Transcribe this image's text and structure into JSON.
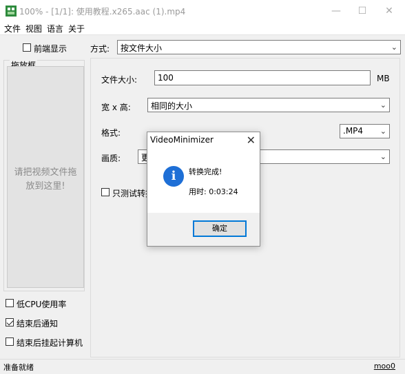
{
  "window": {
    "title": "100% - [1/1]: 使用教程.x265.aac (1).mp4",
    "minimize_glyph": "—",
    "maximize_glyph": "☐",
    "close_glyph": "✕"
  },
  "menu": [
    "文件",
    "视图",
    "语言",
    "关于"
  ],
  "left": {
    "topmost_label": "前端显示",
    "topmost_checked": false,
    "dropzone_legend": "拖放框",
    "dropzone_line1": "请把视频文件拖",
    "dropzone_line2": "放到这里!",
    "options": [
      {
        "label": "低CPU使用率",
        "checked": false
      },
      {
        "label": "结束后通知",
        "checked": true
      },
      {
        "label": "结束后挂起计算机",
        "checked": false
      }
    ]
  },
  "settings": {
    "mode_label": "方式:",
    "mode_value": "按文件大小",
    "size_label": "文件大小:",
    "size_value": "100",
    "size_unit": "MB",
    "resolution_label": "宽 x 高:",
    "resolution_value": "相同的大小",
    "format_label": "格式:",
    "format_value": ".MP4",
    "quality_label": "画质:",
    "quality_value": "更",
    "test_label": "只测试转换",
    "test_checked": false
  },
  "dialog": {
    "title": "VideoMinimizer",
    "message": "转换完成!",
    "elapsed": "用时:    0:03:24",
    "ok_label": "确定",
    "icon_glyph": "i"
  },
  "status": {
    "text": "准备就绪",
    "link": "moo0"
  },
  "colors": {
    "accent": "#0078d7",
    "info_icon": "#1e6fd6",
    "app_icon": "#2e8b3d"
  }
}
